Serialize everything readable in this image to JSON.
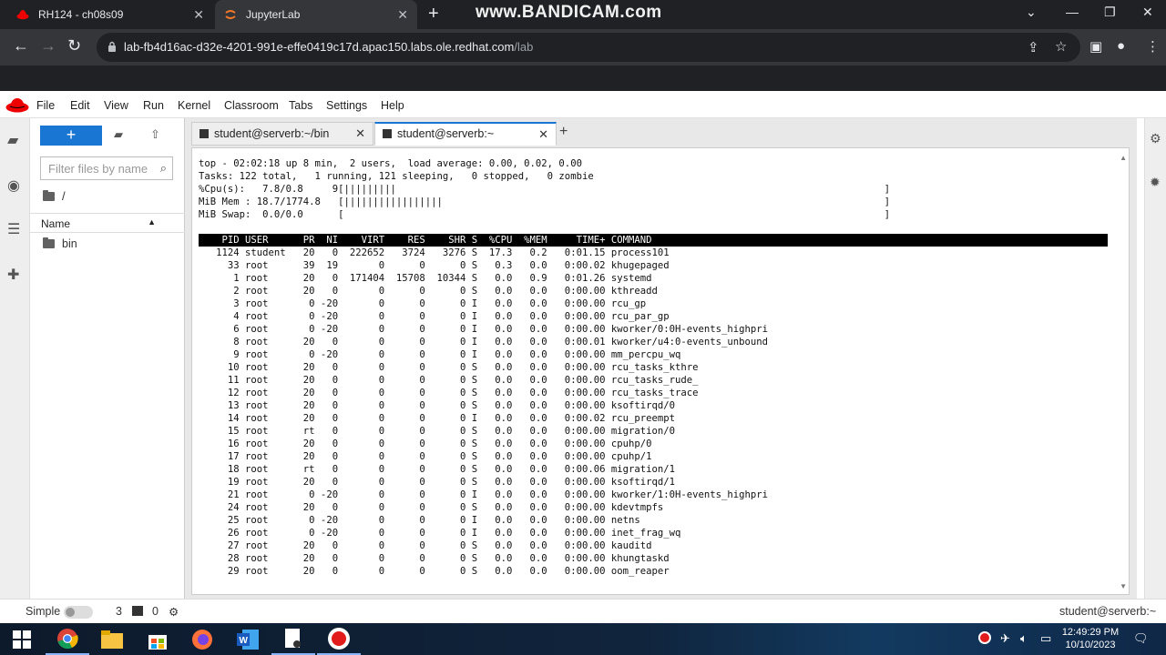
{
  "browser": {
    "tabs": [
      {
        "title": "RH124 - ch08s09",
        "active": false
      },
      {
        "title": "JupyterLab",
        "active": true
      }
    ],
    "watermark": "www.BANDICAM.com",
    "url_main": "lab-fb4d16ac-d32e-4201-991e-effe0419c17d.apac150.labs.ole.redhat.com",
    "url_dim": "/lab"
  },
  "jupyter": {
    "menu": [
      "File",
      "Edit",
      "View",
      "Run",
      "Kernel",
      "Classroom",
      "Tabs",
      "Settings",
      "Help"
    ],
    "filebrowser": {
      "new_label": "+",
      "filter_placeholder": "Filter files by name",
      "breadcrumb": "/",
      "column_name": "Name",
      "items": [
        "bin"
      ]
    },
    "tabs": [
      {
        "title": "student@serverb:~/bin",
        "active": false
      },
      {
        "title": "student@serverb:~",
        "active": true
      }
    ],
    "add_tab": "+",
    "terminal": {
      "summary": [
        "top - 02:02:18 up 8 min,  2 users,  load average: 0.00, 0.02, 0.00",
        "Tasks: 122 total,   1 running, 121 sleeping,   0 stopped,   0 zombie",
        "%Cpu(s):   7.8/0.8     9[|||||||||                                                                                    ]",
        "MiB Mem : 18.7/1774.8   [|||||||||||||||||                                                                            ]",
        "MiB Swap:  0.0/0.0      [                                                                                             ]",
        ""
      ],
      "header": "    PID USER      PR  NI    VIRT    RES    SHR S  %CPU  %MEM     TIME+ COMMAND",
      "processes": [
        "   1124 student   20   0  222652   3724   3276 S  17.3   0.2   0:01.15 process101",
        "     33 root      39  19       0      0      0 S   0.3   0.0   0:00.02 khugepaged",
        "      1 root      20   0  171404  15708  10344 S   0.0   0.9   0:01.26 systemd",
        "      2 root      20   0       0      0      0 S   0.0   0.0   0:00.00 kthreadd",
        "      3 root       0 -20       0      0      0 I   0.0   0.0   0:00.00 rcu_gp",
        "      4 root       0 -20       0      0      0 I   0.0   0.0   0:00.00 rcu_par_gp",
        "      6 root       0 -20       0      0      0 I   0.0   0.0   0:00.00 kworker/0:0H-events_highpri",
        "      8 root      20   0       0      0      0 I   0.0   0.0   0:00.01 kworker/u4:0-events_unbound",
        "      9 root       0 -20       0      0      0 I   0.0   0.0   0:00.00 mm_percpu_wq",
        "     10 root      20   0       0      0      0 S   0.0   0.0   0:00.00 rcu_tasks_kthre",
        "     11 root      20   0       0      0      0 S   0.0   0.0   0:00.00 rcu_tasks_rude_",
        "     12 root      20   0       0      0      0 S   0.0   0.0   0:00.00 rcu_tasks_trace",
        "     13 root      20   0       0      0      0 S   0.0   0.0   0:00.00 ksoftirqd/0",
        "     14 root      20   0       0      0      0 I   0.0   0.0   0:00.02 rcu_preempt",
        "     15 root      rt   0       0      0      0 S   0.0   0.0   0:00.00 migration/0",
        "     16 root      20   0       0      0      0 S   0.0   0.0   0:00.00 cpuhp/0",
        "     17 root      20   0       0      0      0 S   0.0   0.0   0:00.00 cpuhp/1",
        "     18 root      rt   0       0      0      0 S   0.0   0.0   0:00.06 migration/1",
        "     19 root      20   0       0      0      0 S   0.0   0.0   0:00.00 ksoftirqd/1",
        "     21 root       0 -20       0      0      0 I   0.0   0.0   0:00.00 kworker/1:0H-events_highpri",
        "     24 root      20   0       0      0      0 S   0.0   0.0   0:00.00 kdevtmpfs",
        "     25 root       0 -20       0      0      0 I   0.0   0.0   0:00.00 netns",
        "     26 root       0 -20       0      0      0 I   0.0   0.0   0:00.00 inet_frag_wq",
        "     27 root      20   0       0      0      0 S   0.0   0.0   0:00.00 kauditd",
        "     28 root      20   0       0      0      0 S   0.0   0.0   0:00.00 khungtaskd",
        "     29 root      20   0       0      0      0 S   0.0   0.0   0:00.00 oom_reaper"
      ]
    },
    "statusbar": {
      "mode_label": "Simple",
      "kernels_count": "3",
      "terminals_count": "0",
      "right_label": "student@serverb:~"
    }
  },
  "taskbar": {
    "clock_time": "12:49:29 PM",
    "clock_date": "10/10/2023"
  },
  "colors": {
    "accent": "#1976d2",
    "chrome_dark": "#202124",
    "chrome_toolbar": "#35363a",
    "redhat_red": "#ee0000"
  }
}
